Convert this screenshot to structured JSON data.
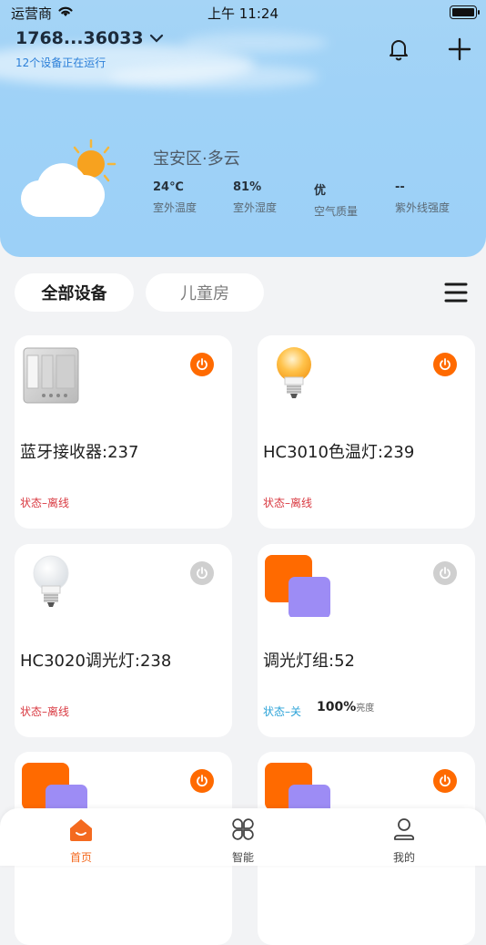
{
  "status_bar": {
    "carrier": "运营商",
    "time": "上午 11:24"
  },
  "header": {
    "account": "1768...36033",
    "devices_running": "12个设备正在运行",
    "location": "宝安区·多云",
    "stats": [
      {
        "value": "24℃",
        "label": "室外温度"
      },
      {
        "value": "81%",
        "label": "室外湿度"
      },
      {
        "value": "优",
        "label": "空气质量"
      },
      {
        "value": "--",
        "label": "紫外线强度"
      }
    ]
  },
  "filters": {
    "all": "全部设备",
    "room": "儿童房"
  },
  "devices": [
    {
      "name": "蓝牙接收器:237",
      "status": "状态–离线",
      "icon": "bluetooth-receiver-icon",
      "power": "on"
    },
    {
      "name": "HC3010色温灯:239",
      "status": "状态–离线",
      "icon": "warm-bulb-icon",
      "power": "on"
    },
    {
      "name": "HC3020调光灯:238",
      "status": "状态–离线",
      "icon": "white-bulb-icon",
      "power": "dim"
    },
    {
      "name": "调光灯组:52",
      "status": "状态–关",
      "brightness": "100%",
      "brightness_label": "亮度",
      "icon": "light-group-icon",
      "power": "dim"
    },
    {
      "name": "",
      "status": "",
      "icon": "light-group-icon",
      "power": "on"
    },
    {
      "name": "",
      "status": "",
      "icon": "light-group-icon",
      "power": "on"
    }
  ],
  "tabbar": {
    "home": "首页",
    "smart": "智能",
    "mine": "我的"
  },
  "colors": {
    "accent": "#ff6a00",
    "offline": "#d93a42",
    "off": "#2ca3d8",
    "link": "#2b7fd8"
  }
}
